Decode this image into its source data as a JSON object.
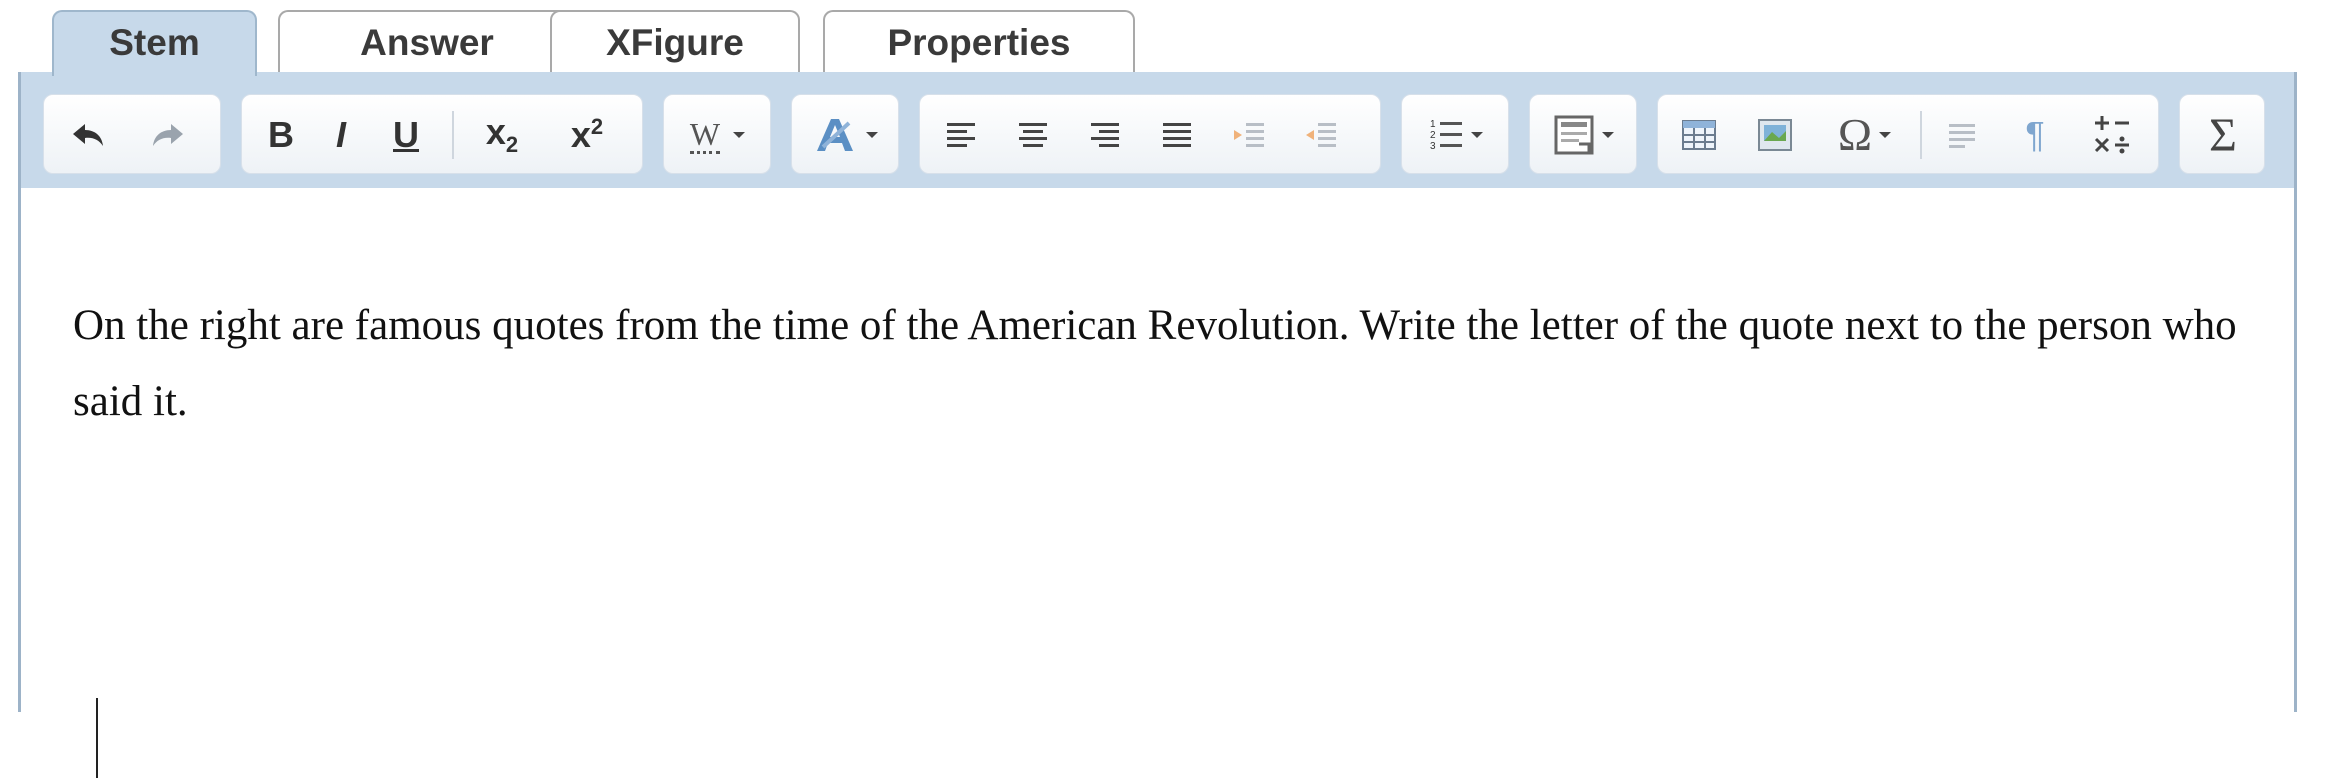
{
  "tabs": [
    {
      "label": "Stem"
    },
    {
      "label": "Answer"
    },
    {
      "label": "XFigure"
    },
    {
      "label": "Properties"
    }
  ],
  "toolbar": {
    "bold_label": "B",
    "italic_label": "I",
    "underline_label": "U",
    "subscript_base": "x",
    "subscript_sub": "2",
    "superscript_base": "x",
    "superscript_sup": "2",
    "word_label": "W",
    "special_char_label": "Ω",
    "sigma_label": "Σ",
    "pilcrow_label": "¶",
    "icons": [
      "undo-icon",
      "redo-icon",
      "bold-icon",
      "italic-icon",
      "underline-icon",
      "subscript-icon",
      "superscript-icon",
      "word-format-icon",
      "font-style-icon",
      "align-left-icon",
      "align-center-icon",
      "align-right-icon",
      "justify-icon",
      "indent-icon",
      "outdent-icon",
      "numbered-list-icon",
      "page-layout-icon",
      "table-icon",
      "image-icon",
      "omega-icon",
      "paragraph-align-icon",
      "pilcrow-icon",
      "math-operators-icon",
      "sigma-icon"
    ]
  },
  "content": {
    "paragraph": "On the right are famous quotes from the time of the American Revolution. Write the letter of the quote next to the person who said it."
  },
  "colors": {
    "toolbar_bg": "#c7d9ea",
    "active_tab": "#c7d9ea",
    "border": "#9db3c8"
  }
}
